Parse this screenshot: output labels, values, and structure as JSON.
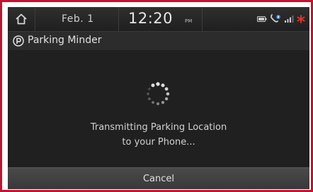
{
  "status_bar": {
    "date": "Feb.  1",
    "time": "12:20",
    "ampm": "PM",
    "icons": [
      "home-icon",
      "battery-icon",
      "bluetooth-phone-icon",
      "signal-icon",
      "alert-icon"
    ]
  },
  "title_bar": {
    "icon": "parking-icon",
    "title": "Parking Minder"
  },
  "content": {
    "spinner": "loading-spinner-icon",
    "message_line1": "Transmitting Parking Location",
    "message_line2": "to your Phone..."
  },
  "actions": {
    "cancel_label": "Cancel"
  },
  "colors": {
    "frame_border": "#c8102e",
    "screen_bg": "#232323",
    "alert": "#e0302a"
  }
}
